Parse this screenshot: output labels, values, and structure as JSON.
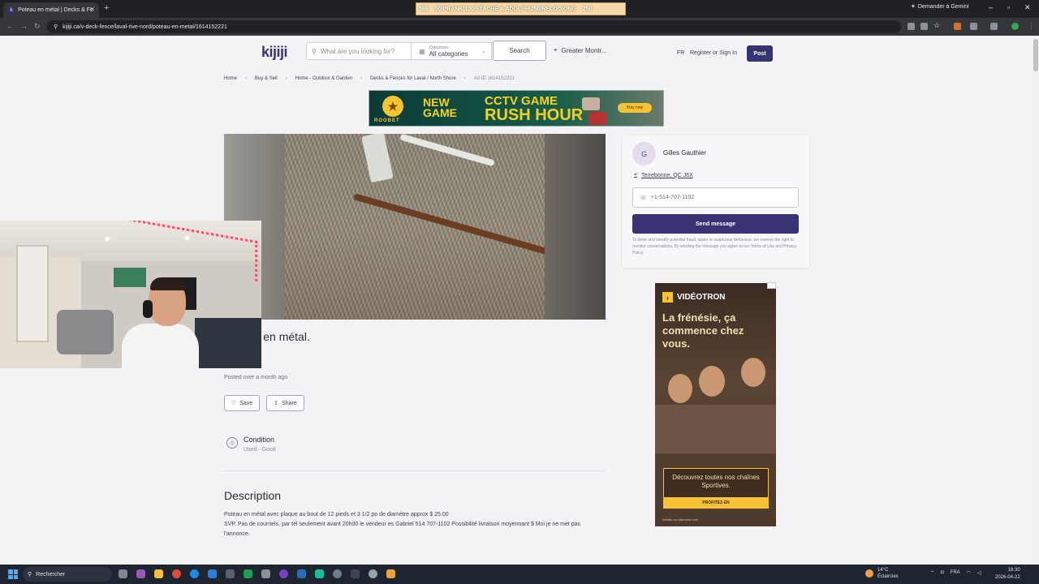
{
  "browser": {
    "tab_title": "Poteau en métal | Decks & Fe",
    "tab_favicon": "k",
    "ticker": [
      "588",
      "50/PRANK|100/STACHE A ADOLPH|250/RELOOKING",
      "250"
    ],
    "gemini": "Demander à Gemini",
    "url": "kijiji.ca/v-deck-fence/laval-rive-nord/poteau-en-metal/1614152221"
  },
  "header": {
    "logo": "kijiji",
    "search_placeholder": "What are you looking for?",
    "category_label": "Categories",
    "category_value": "All categories",
    "search_button": "Search",
    "location": "Greater Montr...",
    "lang": "FR",
    "signin": "Register or Sign In",
    "post": "Post"
  },
  "breadcrumbs": [
    "Home",
    "Buy & Sell",
    "Home - Outdoor & Garden",
    "Decks & Fences for Laval / North Shore"
  ],
  "ad_id": "Ad ID 1614152221",
  "banner": {
    "brand": "ROOBET",
    "line1": "NEW",
    "line2": "GAME",
    "line3": "CCTV GAME",
    "line4": "RUSH HOUR",
    "cta": "Play now"
  },
  "listing": {
    "title": "Poteau en métal.",
    "posted": "Posted over a month ago",
    "save": "Save",
    "share": "Share",
    "condition_label": "Condition",
    "condition_value": "Used - Good",
    "description_heading": "Description",
    "description_line1": "Poteau en métal avec plaque au bout de 12 pieds et 3 1/2 po de diamètre approx $ 25.00",
    "description_line2": "SVP. Pas de courriels, par tél seulement avant 20h00 le vendeur es Gabriel 514 707-1102 Possibilité livraison moyennant $ Moi je ne met pas l'annonce."
  },
  "seller": {
    "initial": "G",
    "name": "Gilles Gauthier",
    "location": "Terrebonne, QC J6X",
    "phone": "+1-514-707-1102",
    "send": "Send message",
    "disclaimer": "To deter and identify potential fraud, spam or suspicious behaviour, we reserve the right to monitor conversations. By sending the message you agree to our Terms of Use and Privacy Policy."
  },
  "side_ad": {
    "brand": "VIDÉOTRON",
    "headline": "La frénésie, ça commence chez vous.",
    "promo": "Découvrez toutes nos chaînes Sportives.",
    "cta": "PROFITEZ-EN",
    "fine": "Détails au videotron.com"
  },
  "taskbar": {
    "search": "Rechercher",
    "temp": "14°C",
    "weather": "Éclaircies",
    "lang": "FRA",
    "time": "18:30",
    "date": "2026-04-22"
  },
  "colors": {
    "brand": "#373373",
    "page_bg": "#f3f3f5"
  }
}
